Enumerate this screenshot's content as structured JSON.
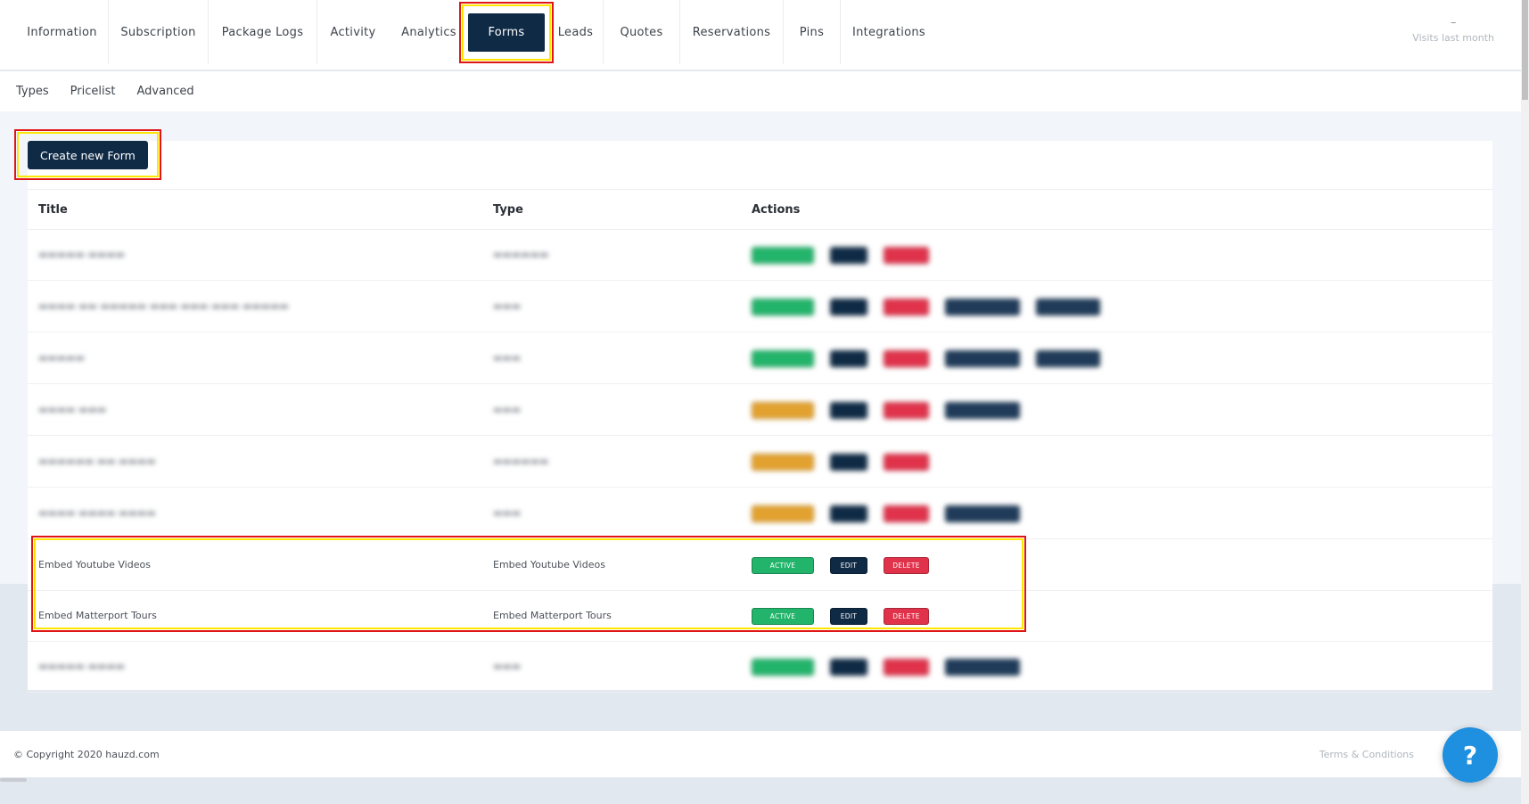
{
  "tabs": [
    {
      "label": "Information"
    },
    {
      "label": "Subscription"
    },
    {
      "label": "Package Logs"
    },
    {
      "label": "Activity"
    },
    {
      "label": "Analytics"
    },
    {
      "label": "Forms"
    },
    {
      "label": "Leads"
    },
    {
      "label": "Quotes"
    },
    {
      "label": "Reservations"
    },
    {
      "label": "Pins"
    },
    {
      "label": "Integrations"
    }
  ],
  "visits": {
    "value": "–",
    "label": "Visits last month"
  },
  "subnav": [
    "Types",
    "Pricelist",
    "Advanced"
  ],
  "create_button": "Create new Form",
  "table": {
    "headers": {
      "title": "Title",
      "type": "Type",
      "actions": "Actions"
    },
    "rows": [
      {
        "title": "Embed Youtube Videos",
        "type": "Embed Youtube Videos",
        "active": "ACTIVE",
        "edit": "EDIT",
        "delete": "DELETE"
      },
      {
        "title": "Embed Matterport Tours",
        "type": "Embed Matterport Tours",
        "active": "ACTIVE",
        "edit": "EDIT",
        "delete": "DELETE"
      }
    ]
  },
  "footer": {
    "copyright": "© Copyright 2020 hauzd.com",
    "terms": "Terms & Conditions"
  },
  "help_label": "?",
  "colors": {
    "navy": "#0f2a45",
    "active_green": "#22b46a",
    "draft_orange": "#e3a22f",
    "delete_red": "#e0334b",
    "help_blue": "#1f8fe0",
    "highlight_red": "#e01515",
    "highlight_yellow": "#ffe600"
  }
}
